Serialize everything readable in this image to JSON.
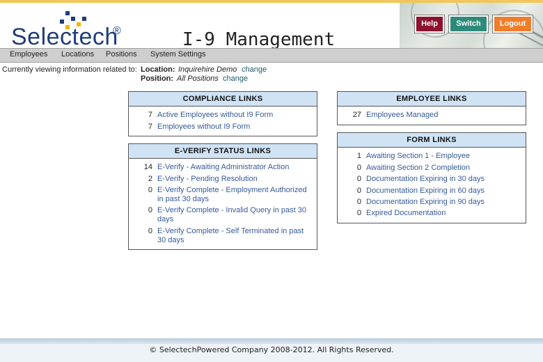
{
  "brand": {
    "name": "Selectech",
    "registered_mark": "®"
  },
  "app_title": "I-9 Management",
  "header_buttons": {
    "help": "Help",
    "switch": "Switch",
    "logout": "Logout"
  },
  "colors": {
    "help_button": "#8c1230",
    "switch_button": "#2d8a7a",
    "logout_button": "#ee7d2c",
    "panel_header": "#cfe3f5",
    "link": "#345a9a"
  },
  "nav": [
    {
      "label": "Employees"
    },
    {
      "label": "Locations"
    },
    {
      "label": "Positions"
    },
    {
      "label": "System Settings"
    }
  ],
  "context": {
    "label": "Currently viewing information related to:",
    "location_key": "Location:",
    "location_value": "Inquirehire Demo",
    "position_key": "Position:",
    "position_value": "All Positions",
    "change_label": "change"
  },
  "compliance": {
    "title": "COMPLIANCE LINKS",
    "items": [
      {
        "count": "7",
        "label": "Active Employees without I9 Form"
      },
      {
        "count": "7",
        "label": "Employees without I9 Form"
      }
    ]
  },
  "everify": {
    "title": "E-VERIFY STATUS LINKS",
    "items": [
      {
        "count": "14",
        "label": "E-Verify - Awaiting Administrator Action"
      },
      {
        "count": "2",
        "label": "E-Verify - Pending Resolution"
      },
      {
        "count": "0",
        "label": "E-Verify Complete - Employment Authorized",
        "label2": "in past 30 days"
      },
      {
        "count": "0",
        "label": "E-Verify Complete - Invalid Query in past 30",
        "label2": "days"
      },
      {
        "count": "0",
        "label": "E-Verify Complete - Self Terminated in past",
        "label2": "30 days"
      }
    ]
  },
  "employee_links": {
    "title": "EMPLOYEE LINKS",
    "items": [
      {
        "count": "27",
        "label": "Employees Managed"
      }
    ]
  },
  "form_links": {
    "title": "FORM LINKS",
    "items": [
      {
        "count": "1",
        "label": "Awaiting Section 1 - Employee"
      },
      {
        "count": "0",
        "label": "Awaiting Section 2 Completion"
      },
      {
        "count": "0",
        "label": "Documentation Expiring in 30 days"
      },
      {
        "count": "0",
        "label": "Documentation Expiring in 60 days"
      },
      {
        "count": "0",
        "label": "Documentation Expiring in 90 days"
      },
      {
        "count": "0",
        "label": "Expired Documentation"
      }
    ]
  },
  "footer": "© SelectechPowered Company 2008-2012. All Rights Reserved."
}
